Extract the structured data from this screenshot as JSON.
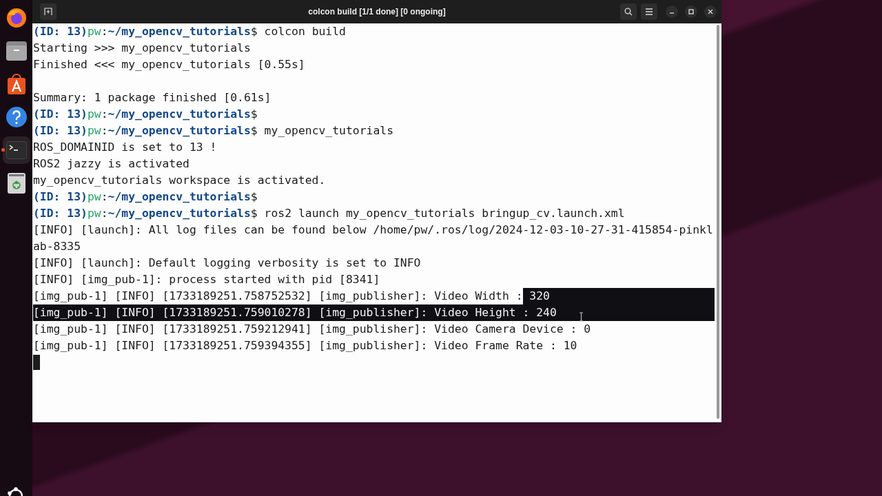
{
  "dock": {
    "items": [
      {
        "kind": "firefox",
        "running": false
      },
      {
        "kind": "files",
        "running": false
      },
      {
        "kind": "appcenter",
        "running": false
      },
      {
        "kind": "help",
        "running": false
      },
      {
        "kind": "terminal",
        "running": true
      },
      {
        "kind": "trash",
        "running": false
      }
    ]
  },
  "window": {
    "title": "colcon build [1/1 done] [0 ongoing]"
  },
  "terminal": {
    "lines": [
      {
        "kind": "prompt",
        "id_label": "(ID: 13)",
        "user": "pw",
        "sep": ":",
        "path": "~/my_opencv_tutorials",
        "symbol": "$",
        "command": "colcon build"
      },
      {
        "kind": "output",
        "segments": [
          {
            "text": "Starting >>> my_opencv_tutorials",
            "selected": false
          }
        ]
      },
      {
        "kind": "output",
        "segments": [
          {
            "text": "Finished <<< my_opencv_tutorials [0.55s]",
            "selected": false
          }
        ]
      },
      {
        "kind": "blank"
      },
      {
        "kind": "output",
        "segments": [
          {
            "text": "Summary: 1 package finished [0.61s]",
            "selected": false
          }
        ]
      },
      {
        "kind": "prompt",
        "id_label": "(ID: 13)",
        "user": "pw",
        "sep": ":",
        "path": "~/my_opencv_tutorials",
        "symbol": "$"
      },
      {
        "kind": "prompt",
        "id_label": "(ID: 13)",
        "user": "pw",
        "sep": ":",
        "path": "~/my_opencv_tutorials",
        "symbol": "$",
        "command": "my_opencv_tutorials"
      },
      {
        "kind": "output",
        "segments": [
          {
            "text": "ROS_DOMAINID is set to 13 !",
            "selected": false
          }
        ]
      },
      {
        "kind": "output",
        "segments": [
          {
            "text": "ROS2 jazzy is activated",
            "selected": false
          }
        ]
      },
      {
        "kind": "output",
        "segments": [
          {
            "text": "my_opencv_tutorials workspace is activated.",
            "selected": false
          }
        ]
      },
      {
        "kind": "prompt",
        "id_label": "(ID: 13)",
        "user": "pw",
        "sep": ":",
        "path": "~/my_opencv_tutorials",
        "symbol": "$"
      },
      {
        "kind": "prompt",
        "id_label": "(ID: 13)",
        "user": "pw",
        "sep": ":",
        "path": "~/my_opencv_tutorials",
        "symbol": "$",
        "command": "ros2 launch my_opencv_tutorials bringup_cv.launch.xml"
      },
      {
        "kind": "output",
        "segments": [
          {
            "text": "[INFO] [launch]: All log files can be found below /home/pw/.ros/log/2024-12-03-10-27-31-415854-pinkl",
            "selected": false
          }
        ]
      },
      {
        "kind": "output",
        "segments": [
          {
            "text": "ab-8335",
            "selected": false
          }
        ]
      },
      {
        "kind": "output",
        "segments": [
          {
            "text": "[INFO] [launch]: Default logging verbosity is set to INFO",
            "selected": false
          }
        ]
      },
      {
        "kind": "output",
        "segments": [
          {
            "text": "[INFO] [img_pub-1]: process started with pid [8341]",
            "selected": false
          }
        ]
      },
      {
        "kind": "output",
        "segments": [
          {
            "text": "[img_pub-1] [INFO] [1733189251.758752532] [img_publisher]: Video Width :",
            "selected": false
          },
          {
            "text": " 320",
            "selected": true
          }
        ]
      },
      {
        "kind": "output",
        "segments": [
          {
            "text": "[img_pub-1] [INFO] [1733189251.759010278] [img_publisher]: Video Height : 240",
            "selected": true
          }
        ]
      },
      {
        "kind": "output",
        "segments": [
          {
            "text": "[img_pub-1] [INFO] [1733189251.759212941] [img_publisher]: Video Camera Device : 0",
            "selected": false
          }
        ]
      },
      {
        "kind": "output",
        "segments": [
          {
            "text": "[img_pub-1] [INFO] [1733189251.759394355] [img_publisher]: Video Frame Rate : 10",
            "selected": false
          }
        ]
      },
      {
        "kind": "cursor"
      }
    ]
  }
}
